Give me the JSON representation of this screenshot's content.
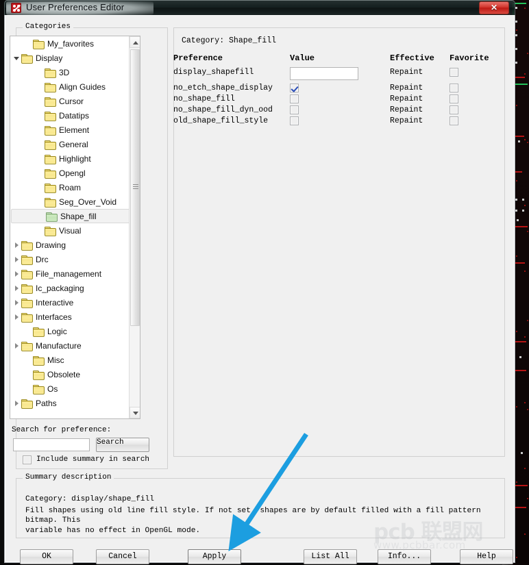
{
  "window": {
    "title": "User Preferences Editor",
    "app_icon": "preferences-dice-icon",
    "close_label": "✕"
  },
  "categories_panel": {
    "legend": "Categories",
    "tree": [
      {
        "label": "My_favorites",
        "indent": 1,
        "expander": "none",
        "selected": false
      },
      {
        "label": "Display",
        "indent": 0,
        "expander": "open",
        "selected": false
      },
      {
        "label": "3D",
        "indent": 2,
        "expander": "none",
        "selected": false
      },
      {
        "label": "Align Guides",
        "indent": 2,
        "expander": "none",
        "selected": false
      },
      {
        "label": "Cursor",
        "indent": 2,
        "expander": "none",
        "selected": false
      },
      {
        "label": "Datatips",
        "indent": 2,
        "expander": "none",
        "selected": false
      },
      {
        "label": "Element",
        "indent": 2,
        "expander": "none",
        "selected": false
      },
      {
        "label": "General",
        "indent": 2,
        "expander": "none",
        "selected": false
      },
      {
        "label": "Highlight",
        "indent": 2,
        "expander": "none",
        "selected": false
      },
      {
        "label": "Opengl",
        "indent": 2,
        "expander": "none",
        "selected": false
      },
      {
        "label": "Roam",
        "indent": 2,
        "expander": "none",
        "selected": false
      },
      {
        "label": "Seg_Over_Void",
        "indent": 2,
        "expander": "none",
        "selected": false
      },
      {
        "label": "Shape_fill",
        "indent": 2,
        "expander": "none",
        "selected": true
      },
      {
        "label": "Visual",
        "indent": 2,
        "expander": "none",
        "selected": false
      },
      {
        "label": "Drawing",
        "indent": 0,
        "expander": "closed",
        "selected": false
      },
      {
        "label": "Drc",
        "indent": 0,
        "expander": "closed",
        "selected": false
      },
      {
        "label": "File_management",
        "indent": 0,
        "expander": "closed",
        "selected": false
      },
      {
        "label": "Ic_packaging",
        "indent": 0,
        "expander": "closed",
        "selected": false
      },
      {
        "label": "Interactive",
        "indent": 0,
        "expander": "closed",
        "selected": false
      },
      {
        "label": "Interfaces",
        "indent": 0,
        "expander": "closed",
        "selected": false
      },
      {
        "label": "Logic",
        "indent": 1,
        "expander": "none",
        "selected": false
      },
      {
        "label": "Manufacture",
        "indent": 0,
        "expander": "closed",
        "selected": false
      },
      {
        "label": "Misc",
        "indent": 1,
        "expander": "none",
        "selected": false
      },
      {
        "label": "Obsolete",
        "indent": 1,
        "expander": "none",
        "selected": false
      },
      {
        "label": "Os",
        "indent": 1,
        "expander": "none",
        "selected": false
      },
      {
        "label": "Paths",
        "indent": 0,
        "expander": "closed",
        "selected": false
      }
    ],
    "scrollbar": {
      "up_arrow": "▲",
      "down_arrow": "▼"
    }
  },
  "search": {
    "label": "Search for preference:",
    "value": "",
    "placeholder": "",
    "button_label": "Search",
    "include_summary_label": "Include summary in search",
    "include_summary_checked": false
  },
  "category_panel": {
    "legend_prefix": "Category:",
    "legend_value": "Shape_fill",
    "legend": "Category:   Shape_fill",
    "headers": {
      "preference": "Preference",
      "value": "Value",
      "effective": "Effective",
      "favorite": "Favorite"
    },
    "rows": [
      {
        "preference": "display_shapefill",
        "value_type": "text",
        "value": "",
        "effective": "Repaint",
        "favorite": false
      },
      {
        "preference": "no_etch_shape_display",
        "value_type": "checkbox",
        "checked": true,
        "effective": "Repaint",
        "favorite": false
      },
      {
        "preference": "no_shape_fill",
        "value_type": "checkbox",
        "checked": false,
        "effective": "Repaint",
        "favorite": false
      },
      {
        "preference": "no_shape_fill_dyn_ood",
        "value_type": "checkbox",
        "checked": false,
        "effective": "Repaint",
        "favorite": false
      },
      {
        "preference": "old_shape_fill_style",
        "value_type": "checkbox",
        "checked": false,
        "effective": "Repaint",
        "favorite": false
      }
    ]
  },
  "summary": {
    "legend": "Summary description",
    "category_line": "Category: display/shape_fill",
    "description_line1": "Fill shapes using old line fill style. If not set, shapes are by default filled with a fill pattern bitmap. This",
    "description_line2": "variable has no effect in OpenGL mode."
  },
  "buttons": {
    "ok": "OK",
    "cancel": "Cancel",
    "apply": "Apply",
    "list_all": "List All",
    "info": "Info...",
    "help": "Help"
  },
  "watermark": {
    "line1": "pcb 联盟网",
    "line2": "www.pcbbar.com"
  },
  "annotation": {
    "arrow_color": "#1c9ee0",
    "points_to": "apply-button"
  }
}
